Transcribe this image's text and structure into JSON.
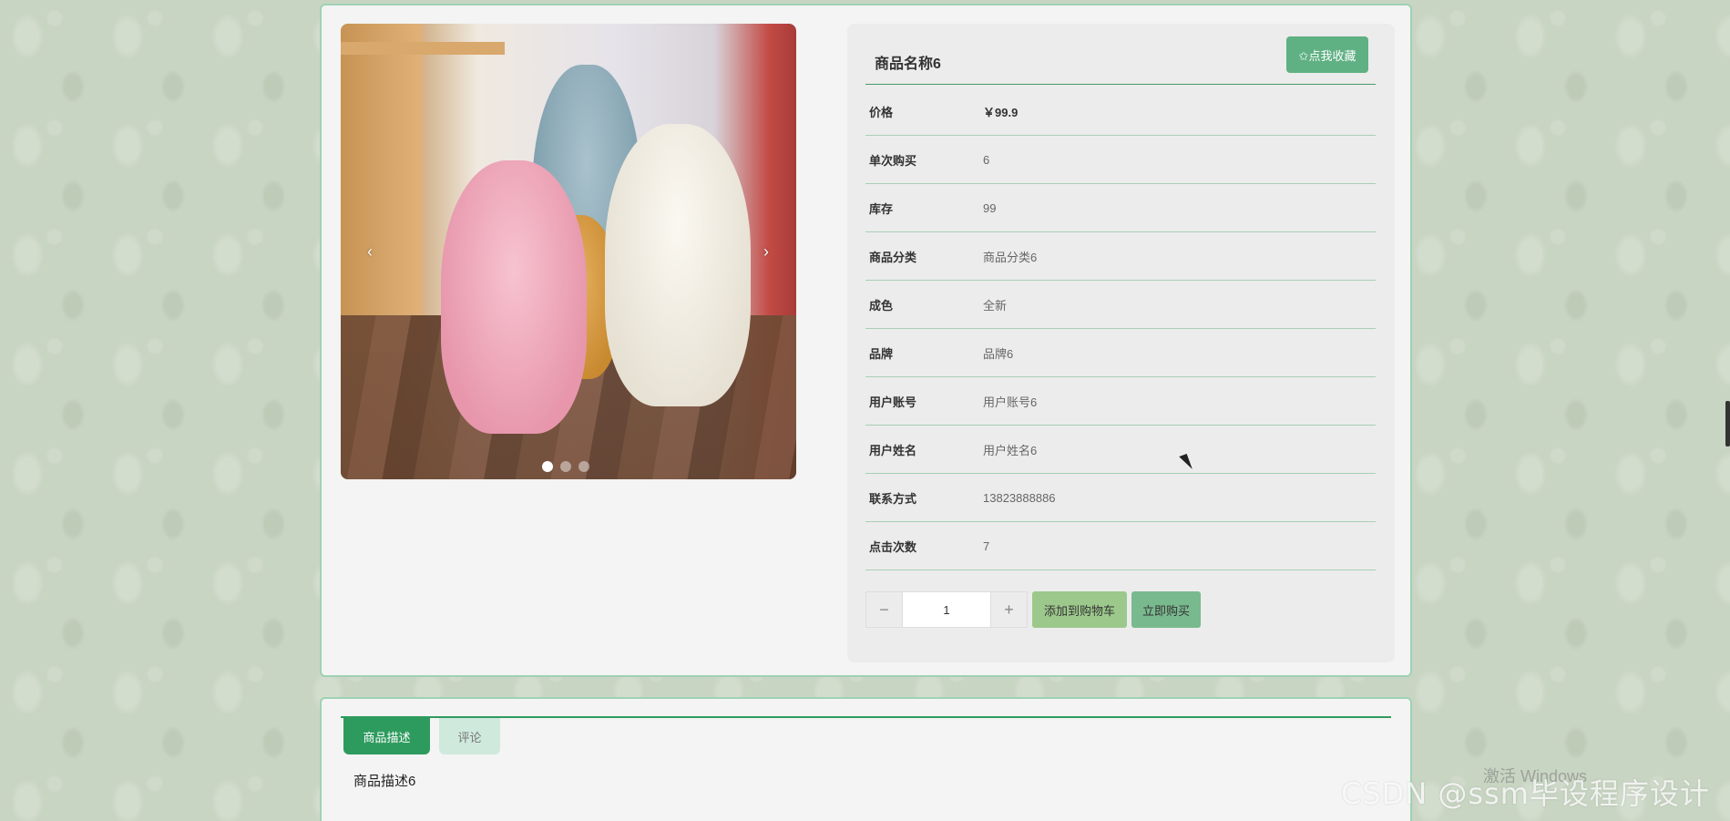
{
  "product": {
    "title": "商品名称6",
    "favorite_label": "✩点我收藏"
  },
  "details": [
    {
      "label": "价格",
      "value": "￥99.9"
    },
    {
      "label": "单次购买",
      "value": "6"
    },
    {
      "label": "库存",
      "value": "99"
    },
    {
      "label": "商品分类",
      "value": "商品分类6"
    },
    {
      "label": "成色",
      "value": "全新"
    },
    {
      "label": "品牌",
      "value": "品牌6"
    },
    {
      "label": "用户账号",
      "value": "用户账号6"
    },
    {
      "label": "用户姓名",
      "value": "用户姓名6"
    },
    {
      "label": "联系方式",
      "value": "13823888886"
    },
    {
      "label": "点击次数",
      "value": "7"
    }
  ],
  "purchase": {
    "decrement": "−",
    "quantity": "1",
    "increment": "+",
    "add_to_cart": "添加到购物车",
    "buy_now": "立即购买"
  },
  "carousel": {
    "prev": "‹",
    "next": "›",
    "slide_count": 3,
    "active_index": 0
  },
  "tabs": [
    {
      "label": "商品描述",
      "active": true
    },
    {
      "label": "评论",
      "active": false
    }
  ],
  "description": "商品描述6",
  "overlay": {
    "watermark": "CSDN @ssm毕设程序设计",
    "activate_windows": "激活 Windows"
  },
  "colors": {
    "accent": "#2e9b5e",
    "favorite_button": "#5fb082",
    "cart_button": "#9cc88c",
    "buy_button": "#79b98e",
    "panel_border": "#9fd1b3"
  }
}
